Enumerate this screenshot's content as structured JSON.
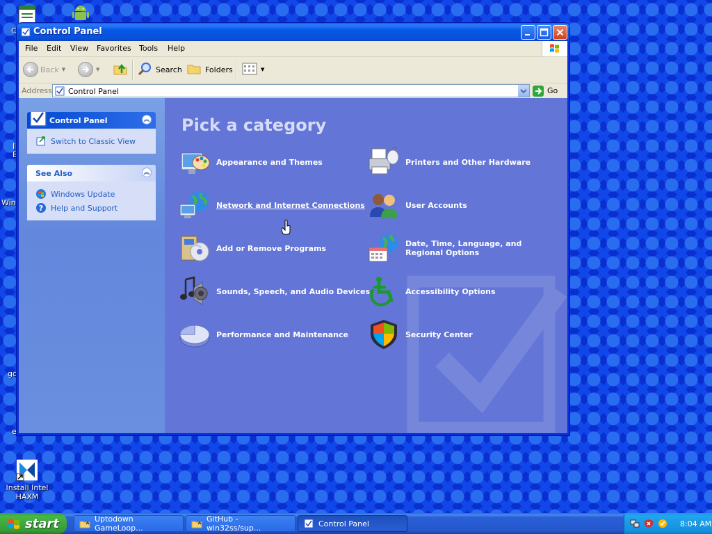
{
  "desktop": {
    "icons": [
      {
        "label": "Install Intel HAXM"
      }
    ],
    "fragments": [
      "C",
      "I",
      "E",
      "Win",
      "gc",
      "e"
    ]
  },
  "window": {
    "title": "Control Panel",
    "menu": [
      "File",
      "Edit",
      "View",
      "Favorites",
      "Tools",
      "Help"
    ],
    "toolbar": {
      "back": "Back",
      "search": "Search",
      "folders": "Folders"
    },
    "address": {
      "label": "Address",
      "value": "Control Panel",
      "go": "Go"
    },
    "sidebar": {
      "main_panel": {
        "title": "Control Panel",
        "links": [
          "Switch to Classic View"
        ]
      },
      "see_also": {
        "title": "See Also",
        "links": [
          "Windows Update",
          "Help and Support"
        ]
      }
    },
    "main": {
      "heading": "Pick a category",
      "categories": [
        {
          "label": "Appearance and Themes",
          "icon": "appearance-themes-icon"
        },
        {
          "label": "Printers and Other Hardware",
          "icon": "printer-icon"
        },
        {
          "label": "Network and Internet Connections",
          "icon": "network-globe-icon"
        },
        {
          "label": "User Accounts",
          "icon": "users-icon"
        },
        {
          "label": "Add or Remove Programs",
          "icon": "add-remove-programs-icon"
        },
        {
          "label": "Date, Time, Language, and Regional Options",
          "icon": "globe-calendar-icon"
        },
        {
          "label": "Sounds, Speech, and Audio Devices",
          "icon": "speaker-icon"
        },
        {
          "label": "Accessibility Options",
          "icon": "accessibility-icon"
        },
        {
          "label": "Performance and Maintenance",
          "icon": "pie-chart-icon"
        },
        {
          "label": "Security Center",
          "icon": "shield-icon"
        }
      ]
    }
  },
  "taskbar": {
    "start": "start",
    "tasks": [
      {
        "label": "Uptodown GameLoop..."
      },
      {
        "label": "GitHub - win32ss/sup..."
      },
      {
        "label": "Control Panel"
      }
    ],
    "clock": "8:04 AM"
  },
  "colors": {
    "main_pane": "#6375d6",
    "title_bar": "#0858e8",
    "link": "#215dc6",
    "start_button": "#3c9c3c",
    "tray": "#1c9ae8"
  }
}
